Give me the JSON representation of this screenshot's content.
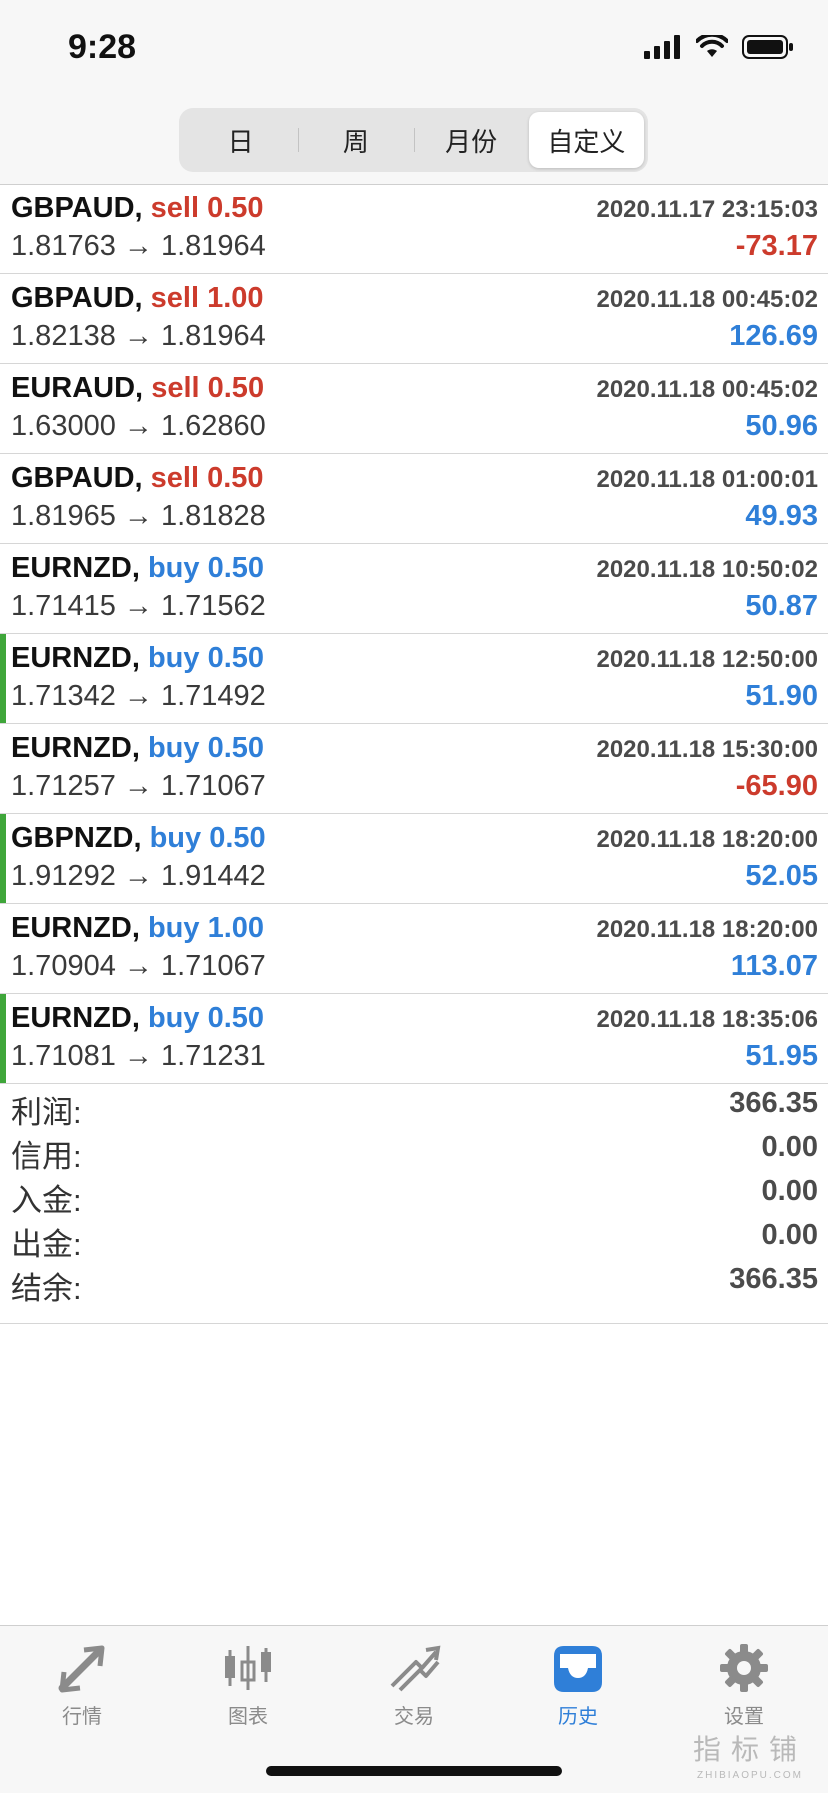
{
  "status_bar": {
    "time": "9:28"
  },
  "period_tabs": [
    {
      "label": "日",
      "active": false
    },
    {
      "label": "周",
      "active": false
    },
    {
      "label": "月份",
      "active": false
    },
    {
      "label": "自定义",
      "active": true
    }
  ],
  "trades": [
    {
      "symbol": "GBPAUD,",
      "side": "sell",
      "volume": "0.50",
      "datetime": "2020.11.17 23:15:03",
      "open": "1.81763",
      "close": "1.81964",
      "arrow": "→",
      "profit": "-73.17",
      "marked": false
    },
    {
      "symbol": "GBPAUD,",
      "side": "sell",
      "volume": "1.00",
      "datetime": "2020.11.18 00:45:02",
      "open": "1.82138",
      "close": "1.81964",
      "arrow": "→",
      "profit": "126.69",
      "marked": false
    },
    {
      "symbol": "EURAUD,",
      "side": "sell",
      "volume": "0.50",
      "datetime": "2020.11.18 00:45:02",
      "open": "1.63000",
      "close": "1.62860",
      "arrow": "→",
      "profit": "50.96",
      "marked": false
    },
    {
      "symbol": "GBPAUD,",
      "side": "sell",
      "volume": "0.50",
      "datetime": "2020.11.18 01:00:01",
      "open": "1.81965",
      "close": "1.81828",
      "arrow": "→",
      "profit": "49.93",
      "marked": false
    },
    {
      "symbol": "EURNZD,",
      "side": "buy",
      "volume": "0.50",
      "datetime": "2020.11.18 10:50:02",
      "open": "1.71415",
      "close": "1.71562",
      "arrow": "→",
      "profit": "50.87",
      "marked": false
    },
    {
      "symbol": "EURNZD,",
      "side": "buy",
      "volume": "0.50",
      "datetime": "2020.11.18 12:50:00",
      "open": "1.71342",
      "close": "1.71492",
      "arrow": "→",
      "profit": "51.90",
      "marked": true
    },
    {
      "symbol": "EURNZD,",
      "side": "buy",
      "volume": "0.50",
      "datetime": "2020.11.18 15:30:00",
      "open": "1.71257",
      "close": "1.71067",
      "arrow": "→",
      "profit": "-65.90",
      "marked": false
    },
    {
      "symbol": "GBPNZD,",
      "side": "buy",
      "volume": "0.50",
      "datetime": "2020.11.18 18:20:00",
      "open": "1.91292",
      "close": "1.91442",
      "arrow": "→",
      "profit": "52.05",
      "marked": true
    },
    {
      "symbol": "EURNZD,",
      "side": "buy",
      "volume": "1.00",
      "datetime": "2020.11.18 18:20:00",
      "open": "1.70904",
      "close": "1.71067",
      "arrow": "→",
      "profit": "113.07",
      "marked": false
    },
    {
      "symbol": "EURNZD,",
      "side": "buy",
      "volume": "0.50",
      "datetime": "2020.11.18 18:35:06",
      "open": "1.71081",
      "close": "1.71231",
      "arrow": "→",
      "profit": "51.95",
      "marked": true
    }
  ],
  "summary": [
    {
      "label": "利润:",
      "value": "366.35"
    },
    {
      "label": "信用:",
      "value": "0.00"
    },
    {
      "label": "入金:",
      "value": "0.00"
    },
    {
      "label": "出金:",
      "value": "0.00"
    },
    {
      "label": "结余:",
      "value": "366.35"
    }
  ],
  "tab_bar": [
    {
      "label": "行情",
      "icon": "quotes-icon",
      "active": false
    },
    {
      "label": "图表",
      "icon": "chart-candles-icon",
      "active": false
    },
    {
      "label": "交易",
      "icon": "trade-icon",
      "active": false
    },
    {
      "label": "历史",
      "icon": "history-inbox-icon",
      "active": true
    },
    {
      "label": "设置",
      "icon": "gear-icon",
      "active": false
    }
  ],
  "watermark": {
    "text_cn": "指标铺",
    "text_en": "ZHIBIAOPU.COM"
  },
  "colors": {
    "sell": "#cc3b2c",
    "buy": "#2f7fd8",
    "marker": "#3fa63a",
    "tab_active": "#2f7fd8",
    "tab_inactive": "#8b8b8b"
  }
}
